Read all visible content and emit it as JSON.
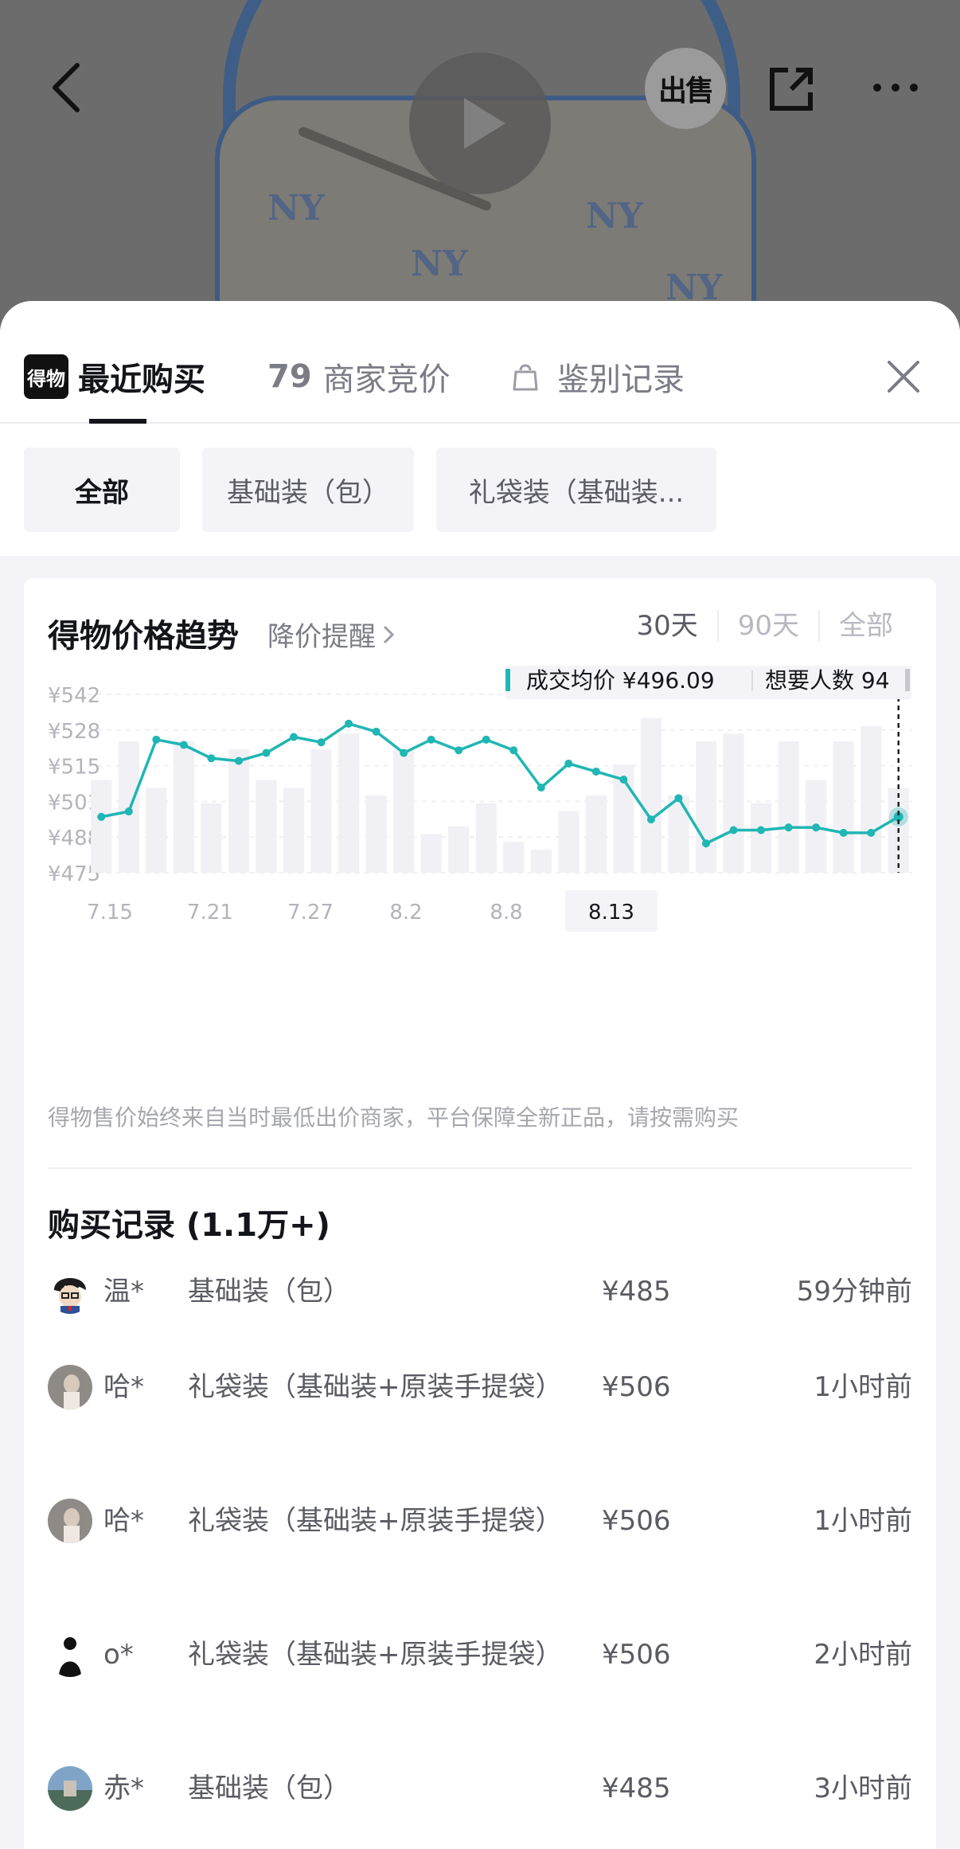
{
  "colors": {
    "accent": "#1fb6b4",
    "text_primary": "#14151a",
    "text_secondary": "#7b7c85",
    "bar": "#f1f1f5"
  },
  "top_bar": {
    "back_icon": "chevron-left-icon",
    "play_icon": "play-icon",
    "sell_label": "出售",
    "share_icon": "share-icon",
    "more_icon": "more-icon"
  },
  "tabs": [
    {
      "logo": "得物",
      "label": "最近购买",
      "active": true
    },
    {
      "count": "79",
      "label": "商家竞价",
      "active": false
    },
    {
      "icon": "bag-icon",
      "label": "鉴别记录",
      "active": false
    }
  ],
  "close_icon": "close-icon",
  "filters": [
    {
      "label": "全部",
      "active": true
    },
    {
      "label": "基础装（包）",
      "active": false
    },
    {
      "label": "礼袋装（基础装...",
      "active": false
    }
  ],
  "trend": {
    "title": "得物价格趋势",
    "drop_alert": "降价提醒",
    "ranges": [
      {
        "label": "30天",
        "active": true
      },
      {
        "label": "90天",
        "active": false
      },
      {
        "label": "全部",
        "active": false
      }
    ],
    "note": "得物售价始终来自当时最低出价商家，平台保障全新正品，请按需购买"
  },
  "chart_data": {
    "type": "line",
    "tooltip": {
      "avg_label": "成交均价 ¥496.09",
      "want_label": "想要人数 94"
    },
    "y_ticks": [
      "¥542",
      "¥528",
      "¥515",
      "¥501",
      "¥488",
      "¥475"
    ],
    "ylim": [
      475,
      542
    ],
    "x_ticks": [
      "7.15",
      "7.21",
      "7.27",
      "8.2",
      "8.8",
      "8.13"
    ],
    "highlighted_x_tick": "8.13",
    "grid": true,
    "series": [
      {
        "values": [
          496,
          498,
          525,
          523,
          518,
          517,
          520,
          526,
          524,
          531,
          528,
          520,
          525,
          521,
          525,
          521,
          507,
          516,
          513,
          510,
          495,
          503,
          486,
          491,
          491,
          492,
          492,
          490,
          490,
          496
        ]
      }
    ],
    "bars": [
      12,
      17,
      11,
      17,
      9,
      16,
      12,
      11,
      16,
      18,
      10,
      16,
      5,
      6,
      9,
      4,
      3,
      8,
      10,
      14,
      20,
      10,
      17,
      18,
      9,
      17,
      12,
      17,
      19,
      11
    ]
  },
  "records": {
    "title": "购买记录 (1.1万+)",
    "items": [
      {
        "user": "温*",
        "spec": "基础装（包）",
        "price": "¥485",
        "time": "59分钟前",
        "avatar": "anime-avatar"
      },
      {
        "user": "哈*",
        "spec": "礼袋装（基础装+原装手提袋）",
        "price": "¥506",
        "time": "1小时前",
        "avatar": "photo-avatar"
      },
      {
        "user": "哈*",
        "spec": "礼袋装（基础装+原装手提袋）",
        "price": "¥506",
        "time": "1小时前",
        "avatar": "photo-avatar"
      },
      {
        "user": "o*",
        "spec": "礼袋装（基础装+原装手提袋）",
        "price": "¥506",
        "time": "2小时前",
        "avatar": "silhouette-avatar"
      },
      {
        "user": "赤*",
        "spec": "基础装（包）",
        "price": "¥485",
        "time": "3小时前",
        "avatar": "landscape-avatar"
      }
    ]
  }
}
